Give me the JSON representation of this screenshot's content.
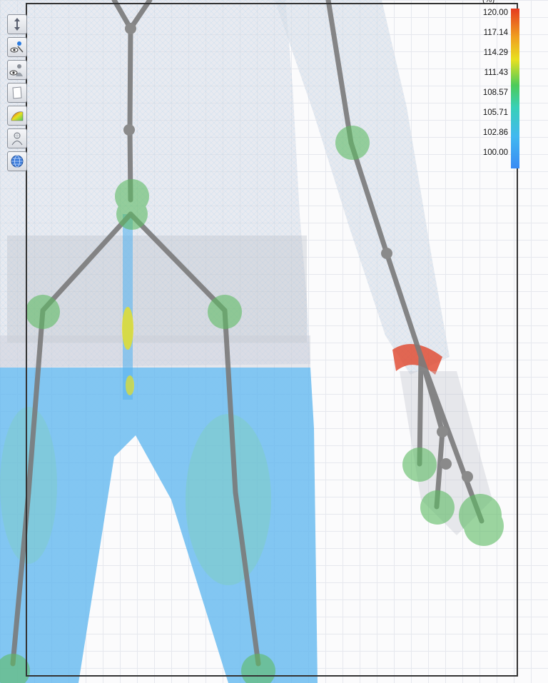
{
  "legend": {
    "unit": "(%)",
    "ticks": [
      "120.00",
      "117.14",
      "114.29",
      "111.43",
      "108.57",
      "105.71",
      "102.86",
      "100.00"
    ],
    "colors": [
      "#e53b1f",
      "#f0a020",
      "#e8e020",
      "#4ccb5a",
      "#38d0b8",
      "#41b8f0",
      "#3a8cf4"
    ]
  },
  "toolbar": {
    "tools": [
      {
        "icon": "move-arrows-icon"
      },
      {
        "icon": "visibility-pointer-icon"
      },
      {
        "icon": "visibility-avatar-icon"
      },
      {
        "icon": "paper-sheet-icon"
      },
      {
        "icon": "heatmap-map-icon"
      },
      {
        "icon": "avatar-grid-icon"
      },
      {
        "icon": "globe-view-icon"
      }
    ]
  },
  "scene": {
    "garment_color": "#5ab4ef",
    "skeleton_color": "#7a7a7a",
    "joint_color": "#5dbb63"
  }
}
